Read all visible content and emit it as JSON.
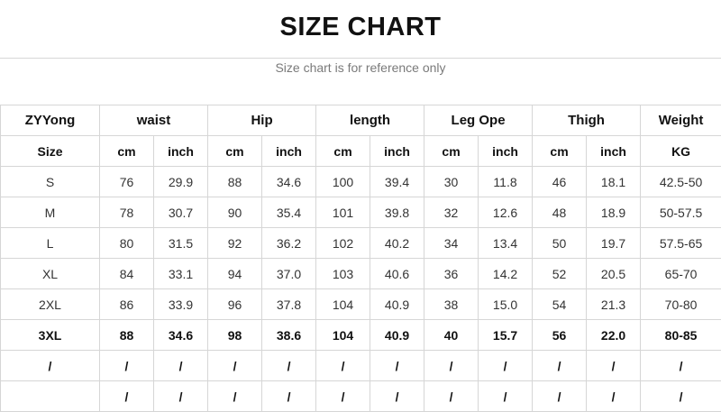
{
  "title": "SIZE CHART",
  "subtitle": "Size chart is for reference only",
  "table": {
    "brand": "ZYYong",
    "groups": [
      "waist",
      "Hip",
      "length",
      "Leg Ope",
      "Thigh",
      "Weight"
    ],
    "size_label": "Size",
    "units": [
      "cm",
      "inch",
      "cm",
      "inch",
      "cm",
      "inch",
      "cm",
      "inch",
      "cm",
      "inch",
      "KG"
    ],
    "rows": [
      [
        "S",
        "76",
        "29.9",
        "88",
        "34.6",
        "100",
        "39.4",
        "30",
        "11.8",
        "46",
        "18.1",
        "42.5-50"
      ],
      [
        "M",
        "78",
        "30.7",
        "90",
        "35.4",
        "101",
        "39.8",
        "32",
        "12.6",
        "48",
        "18.9",
        "50-57.5"
      ],
      [
        "L",
        "80",
        "31.5",
        "92",
        "36.2",
        "102",
        "40.2",
        "34",
        "13.4",
        "50",
        "19.7",
        "57.5-65"
      ],
      [
        "XL",
        "84",
        "33.1",
        "94",
        "37.0",
        "103",
        "40.6",
        "36",
        "14.2",
        "52",
        "20.5",
        "65-70"
      ],
      [
        "2XL",
        "86",
        "33.9",
        "96",
        "37.8",
        "104",
        "40.9",
        "38",
        "15.0",
        "54",
        "21.3",
        "70-80"
      ],
      [
        "3XL",
        "88",
        "34.6",
        "98",
        "38.6",
        "104",
        "40.9",
        "40",
        "15.7",
        "56",
        "22.0",
        "80-85"
      ],
      [
        "/",
        "/",
        "/",
        "/",
        "/",
        "/",
        "/",
        "/",
        "/",
        "/",
        "/",
        "/"
      ],
      [
        "",
        "/",
        "/",
        "/",
        "/",
        "/",
        "/",
        "/",
        "/",
        "/",
        "/",
        "/"
      ]
    ]
  }
}
